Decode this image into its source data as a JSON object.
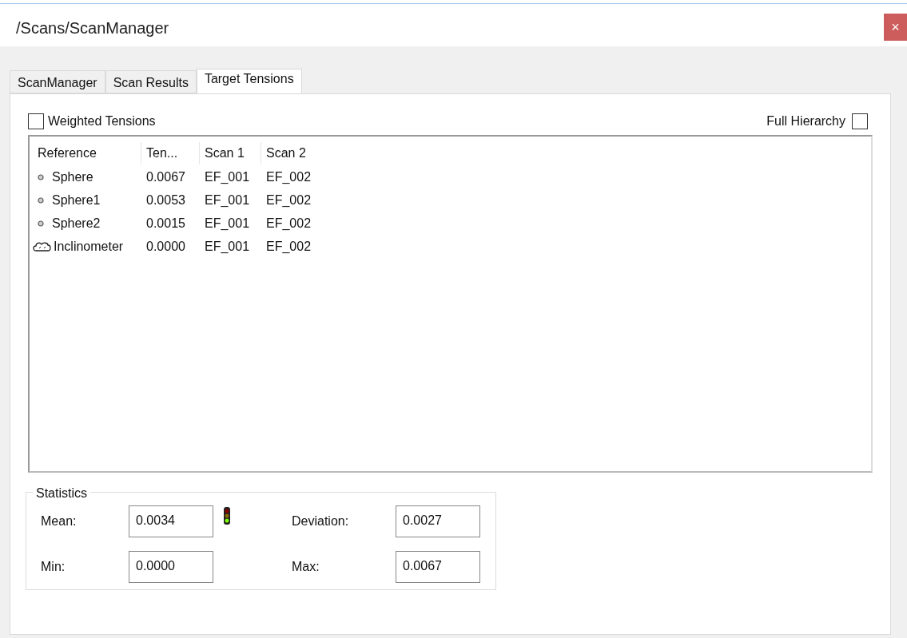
{
  "window": {
    "title": "/Scans/ScanManager",
    "close": "×"
  },
  "tabs": [
    {
      "label": "ScanManager",
      "selected": false
    },
    {
      "label": "Scan Results",
      "selected": false
    },
    {
      "label": "Target Tensions",
      "selected": true
    }
  ],
  "options": [
    {
      "label": "Weighted Tensions",
      "checked": false
    },
    {
      "label": "Full Hierarchy",
      "checked": false
    }
  ],
  "table": {
    "columns": [
      "Reference",
      "Ten...",
      "Scan 1",
      "Scan 2"
    ],
    "rows": [
      {
        "kind": "sphere",
        "cells": [
          "Sphere",
          "0.0067",
          "EF_001",
          "EF_002"
        ]
      },
      {
        "kind": "sphere",
        "cells": [
          "Sphere1",
          "0.0053",
          "EF_001",
          "EF_002"
        ]
      },
      {
        "kind": "sphere",
        "cells": [
          "Sphere2",
          "0.0015",
          "EF_001",
          "EF_002"
        ]
      },
      {
        "kind": "inclinometer",
        "cells": [
          "Inclinometer",
          "0.0000",
          "EF_001",
          "EF_002"
        ]
      }
    ]
  },
  "statistics": {
    "title": "Statistics",
    "fields": [
      {
        "label": "Mean:",
        "value": "0.0034"
      },
      {
        "label": "Deviation:",
        "value": "0.0027"
      },
      {
        "label": "Min:",
        "value": "0.0000"
      },
      {
        "label": "Max:",
        "value": "0.0067"
      }
    ]
  }
}
